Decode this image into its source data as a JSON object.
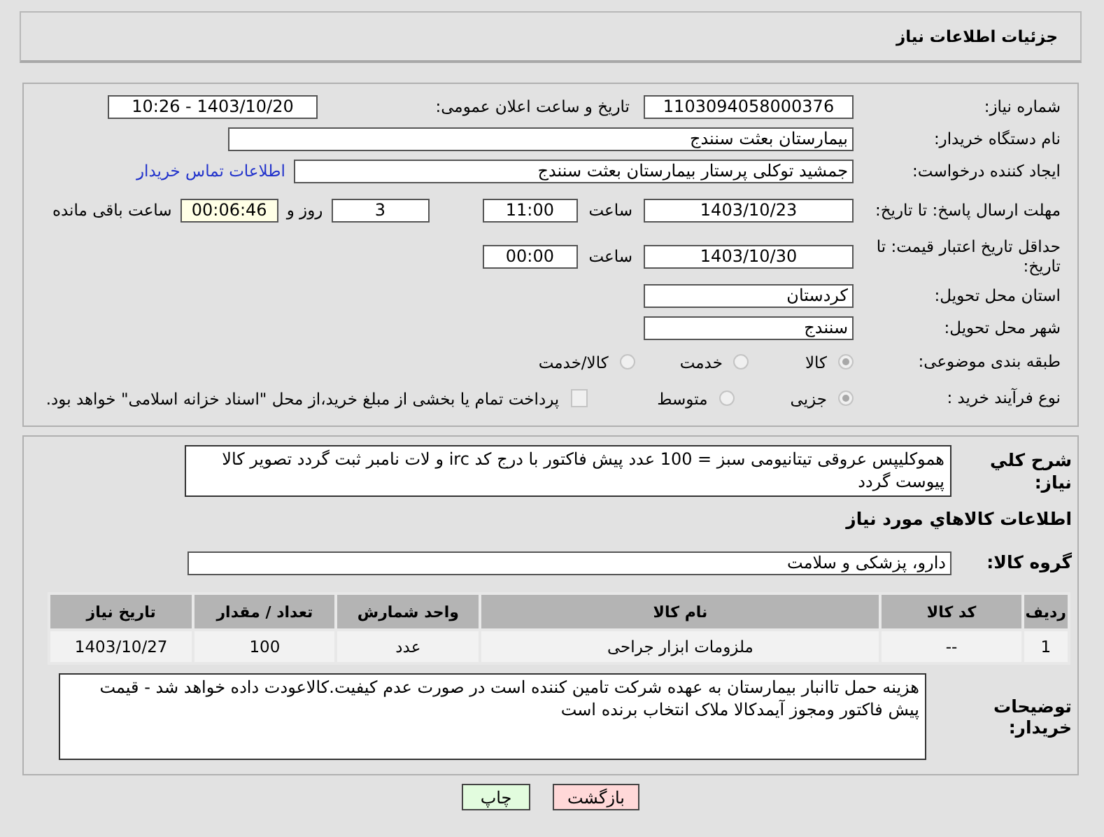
{
  "header": {
    "title": "جزئیات اطلاعات نیاز"
  },
  "request": {
    "number": {
      "label": "شماره نیاز:",
      "value": "1103094058000376"
    },
    "announce": {
      "label": "تاریخ و ساعت اعلان عمومی:",
      "value": "1403/10/20 - 10:26"
    },
    "buyer_org": {
      "label": "نام دستگاه خریدار:",
      "value": "بیمارستان بعثت سنندج"
    },
    "requester": {
      "label": "ایجاد کننده درخواست:",
      "value": "جمشید  توکلی پرستار بیمارستان بعثت سنندج",
      "link": "اطلاعات تماس خریدار"
    },
    "reply_deadline": {
      "label": "مهلت ارسال پاسخ: تا تاریخ:",
      "date": "1403/10/23",
      "time_label": "ساعت",
      "time": "11:00",
      "days": "3",
      "days_label": "روز و",
      "remaining": "00:06:46",
      "remaining_label": "ساعت باقی مانده"
    },
    "price_validity": {
      "label": "حداقل تاریخ اعتبار قیمت: تا تاریخ:",
      "date": "1403/10/30",
      "time_label": "ساعت",
      "time": "00:00"
    },
    "province": {
      "label": "استان محل تحویل:",
      "value": "کردستان"
    },
    "city": {
      "label": "شهر محل تحویل:",
      "value": "سنندج"
    },
    "category": {
      "label": "طبقه بندی موضوعی:",
      "options": [
        {
          "label": "کالا",
          "selected": true
        },
        {
          "label": "خدمت",
          "selected": false
        },
        {
          "label": "کالا/خدمت",
          "selected": false
        }
      ]
    },
    "process": {
      "label": "نوع فرآیند خرید :",
      "options": [
        {
          "label": "جزیی",
          "selected": true
        },
        {
          "label": "متوسط",
          "selected": false
        }
      ],
      "treasury": {
        "label": "پرداخت تمام یا بخشی از مبلغ خرید،از محل \"اسناد خزانه اسلامی\" خواهد بود.",
        "checked": false
      }
    }
  },
  "details": {
    "description": {
      "label": "شرح کلي نياز:",
      "value": "هموکلیپس عروقی تیتانیومی سبز = 100 عدد پیش فاکتور با درج کد irc و لات نامبر ثبت گردد تصویر کالا پیوست گردد"
    },
    "items_heading": "اطلاعات کالاهاي مورد نياز",
    "group": {
      "label": "گروه کالا:",
      "value": "دارو، پزشکی و سلامت"
    },
    "table": {
      "columns": [
        "ردیف",
        "کد کالا",
        "نام کالا",
        "واحد شمارش",
        "تعداد / مقدار",
        "تاریخ نیاز"
      ],
      "rows": [
        [
          "1",
          "--",
          "ملزومات ابزار جراحی",
          "عدد",
          "100",
          "1403/10/27"
        ]
      ]
    },
    "buyer_notes": {
      "label": "توضیحات خریدار:",
      "value": "هزینه حمل تاانبار بیمارستان به عهده شرکت تامین کننده است در صورت عدم کیفیت.کالاعودت داده خواهد شد - قیمت پیش فاکتور ومجوز آیمدکالا ملاک انتخاب برنده است"
    }
  },
  "buttons": [
    {
      "label": "بازگشت",
      "kind": "back"
    },
    {
      "label": "چاپ",
      "kind": "print"
    }
  ]
}
